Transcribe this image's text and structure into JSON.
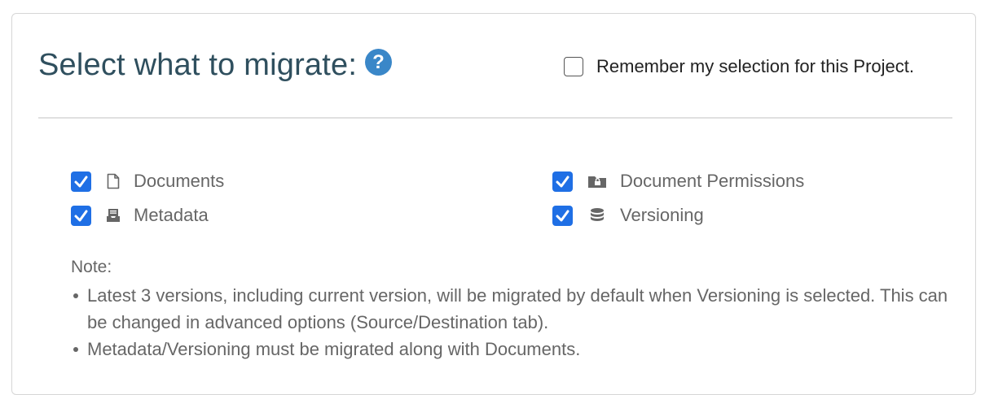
{
  "header": {
    "title": "Select what to migrate:",
    "help_icon": "question-circle-icon",
    "remember_label": "Remember my selection for this Project.",
    "remember_checked": false
  },
  "options": [
    {
      "label": "Documents",
      "checked": true,
      "icon": "file-icon"
    },
    {
      "label": "Metadata",
      "checked": true,
      "icon": "inbox-tray-icon"
    },
    {
      "label": "Document Permissions",
      "checked": true,
      "icon": "folder-lock-icon"
    },
    {
      "label": "Versioning",
      "checked": true,
      "icon": "database-icon"
    }
  ],
  "note": {
    "title": "Note:",
    "items": [
      "Latest 3 versions, including current version, will be migrated by default when Versioning is selected. This can be changed in advanced options (Source/Destination tab).",
      "Metadata/Versioning must be migrated along with Documents."
    ]
  },
  "colors": {
    "accent": "#1f6fe5",
    "help": "#3a87c8",
    "title": "#2f4f5e"
  }
}
